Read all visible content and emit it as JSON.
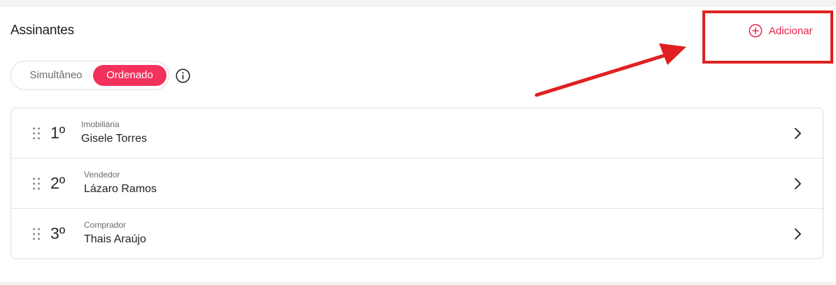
{
  "section": {
    "title": "Assinantes"
  },
  "add_button": {
    "label": "Adicionar"
  },
  "mode_toggle": {
    "options": [
      "Simultâneo",
      "Ordenado"
    ],
    "selected": "Ordenado"
  },
  "signers": [
    {
      "order": "1º",
      "role": "Imobiliária",
      "name": "Gisele Torres"
    },
    {
      "order": "2º",
      "role": "Vendedor",
      "name": "Lázaro Ramos"
    },
    {
      "order": "3º",
      "role": "Comprador",
      "name": "Thais Araújo"
    }
  ],
  "colors": {
    "accent": "#f2325c",
    "accent_text": "#e8204b",
    "annotation": "#e02020"
  },
  "icons": {
    "add": "plus-circle-icon",
    "info": "info-icon",
    "drag": "drag-handle-icon",
    "row_action": "chevron-right-icon"
  }
}
